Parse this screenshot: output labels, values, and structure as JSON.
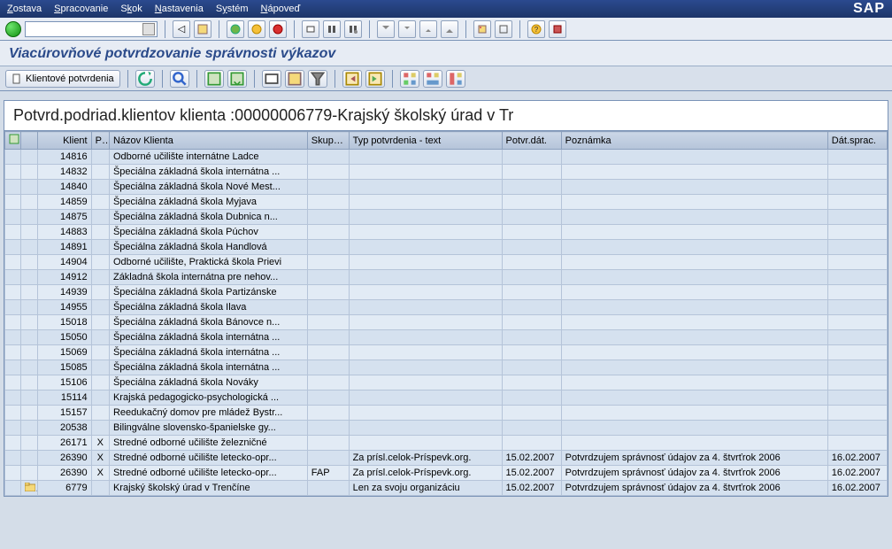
{
  "menu": {
    "items": [
      "Zostava",
      "Spracovanie",
      "Skok",
      "Nastavenia",
      "Systém",
      "Nápoveď"
    ],
    "logo": "SAP"
  },
  "page_title": "Viacúrovňové potvrdzovanie správnosti výkazov",
  "app_toolbar": {
    "client_confirm_label": "Klientové potvrdenia"
  },
  "grid": {
    "title": "Potvrd.podriad.klientov klienta :00000006779-Krajský školský úrad v Tr",
    "columns": {
      "klient": "Klient",
      "po": "PO",
      "nazov": "Názov Klienta",
      "skup": "SkupP...",
      "typ": "Typ potvrdenia - text",
      "potvr_dat": "Potvr.dát.",
      "poznamka": "Poznámka",
      "dat_sprac": "Dát.sprac."
    },
    "rows": [
      {
        "klient": "14816",
        "po": "",
        "nazov": "Odborné učilište internátne Ladce",
        "skup": "",
        "typ": "",
        "potvr": "",
        "pozn": "",
        "sprac": "",
        "icon": ""
      },
      {
        "klient": "14832",
        "po": "",
        "nazov": "Špeciálna základná škola internátna ...",
        "skup": "",
        "typ": "",
        "potvr": "",
        "pozn": "",
        "sprac": "",
        "icon": ""
      },
      {
        "klient": "14840",
        "po": "",
        "nazov": "Špeciálna základná škola Nové Mest...",
        "skup": "",
        "typ": "",
        "potvr": "",
        "pozn": "",
        "sprac": "",
        "icon": ""
      },
      {
        "klient": "14859",
        "po": "",
        "nazov": "Špeciálna základná škola Myjava",
        "skup": "",
        "typ": "",
        "potvr": "",
        "pozn": "",
        "sprac": "",
        "icon": ""
      },
      {
        "klient": "14875",
        "po": "",
        "nazov": "Špeciálna základná škola Dubnica n...",
        "skup": "",
        "typ": "",
        "potvr": "",
        "pozn": "",
        "sprac": "",
        "icon": ""
      },
      {
        "klient": "14883",
        "po": "",
        "nazov": "Špeciálna základná škola Púchov",
        "skup": "",
        "typ": "",
        "potvr": "",
        "pozn": "",
        "sprac": "",
        "icon": ""
      },
      {
        "klient": "14891",
        "po": "",
        "nazov": "Špeciálna základná škola Handlová",
        "skup": "",
        "typ": "",
        "potvr": "",
        "pozn": "",
        "sprac": "",
        "icon": ""
      },
      {
        "klient": "14904",
        "po": "",
        "nazov": "Odborné učilište, Praktická škola Prievi",
        "skup": "",
        "typ": "",
        "potvr": "",
        "pozn": "",
        "sprac": "",
        "icon": ""
      },
      {
        "klient": "14912",
        "po": "",
        "nazov": "Základná škola internátna pre nehov...",
        "skup": "",
        "typ": "",
        "potvr": "",
        "pozn": "",
        "sprac": "",
        "icon": ""
      },
      {
        "klient": "14939",
        "po": "",
        "nazov": "Špeciálna základná škola Partizánske",
        "skup": "",
        "typ": "",
        "potvr": "",
        "pozn": "",
        "sprac": "",
        "icon": ""
      },
      {
        "klient": "14955",
        "po": "",
        "nazov": "Špeciálna základná škola Ilava",
        "skup": "",
        "typ": "",
        "potvr": "",
        "pozn": "",
        "sprac": "",
        "icon": ""
      },
      {
        "klient": "15018",
        "po": "",
        "nazov": "Špeciálna základná škola Bánovce n...",
        "skup": "",
        "typ": "",
        "potvr": "",
        "pozn": "",
        "sprac": "",
        "icon": ""
      },
      {
        "klient": "15050",
        "po": "",
        "nazov": "Špeciálna základná škola internátna ...",
        "skup": "",
        "typ": "",
        "potvr": "",
        "pozn": "",
        "sprac": "",
        "icon": ""
      },
      {
        "klient": "15069",
        "po": "",
        "nazov": "Špeciálna základná škola internátna ...",
        "skup": "",
        "typ": "",
        "potvr": "",
        "pozn": "",
        "sprac": "",
        "icon": ""
      },
      {
        "klient": "15085",
        "po": "",
        "nazov": "Špeciálna základná škola internátna ...",
        "skup": "",
        "typ": "",
        "potvr": "",
        "pozn": "",
        "sprac": "",
        "icon": ""
      },
      {
        "klient": "15106",
        "po": "",
        "nazov": "Špeciálna základná škola Nováky",
        "skup": "",
        "typ": "",
        "potvr": "",
        "pozn": "",
        "sprac": "",
        "icon": ""
      },
      {
        "klient": "15114",
        "po": "",
        "nazov": "Krajská pedagogicko-psychologická ...",
        "skup": "",
        "typ": "",
        "potvr": "",
        "pozn": "",
        "sprac": "",
        "icon": ""
      },
      {
        "klient": "15157",
        "po": "",
        "nazov": "Reedukačný domov pre mládež Bystr...",
        "skup": "",
        "typ": "",
        "potvr": "",
        "pozn": "",
        "sprac": "",
        "icon": ""
      },
      {
        "klient": "20538",
        "po": "",
        "nazov": "Bilingválne slovensko-španielske gy...",
        "skup": "",
        "typ": "",
        "potvr": "",
        "pozn": "",
        "sprac": "",
        "icon": ""
      },
      {
        "klient": "26171",
        "po": "X",
        "nazov": "Stredné odborné učilište železničné",
        "skup": "",
        "typ": "",
        "potvr": "",
        "pozn": "",
        "sprac": "",
        "icon": ""
      },
      {
        "klient": "26390",
        "po": "X",
        "nazov": "Stredné odborné učilište letecko-opr...",
        "skup": "",
        "typ": "Za prísl.celok-Príspevk.org.",
        "potvr": "15.02.2007",
        "pozn": "Potvrdzujem správnosť údajov za 4. štvrťrok 2006",
        "sprac": "16.02.2007",
        "icon": ""
      },
      {
        "klient": "26390",
        "po": "X",
        "nazov": "Stredné odborné učilište letecko-opr...",
        "skup": "FAP",
        "typ": "Za prísl.celok-Príspevk.org.",
        "potvr": "15.02.2007",
        "pozn": "Potvrdzujem správnosť údajov za 4. štvrťrok 2006",
        "sprac": "16.02.2007",
        "icon": ""
      },
      {
        "klient": "6779",
        "po": "",
        "nazov": "Krajský školský úrad v Trenčíne",
        "skup": "",
        "typ": "Len za svoju organizáciu",
        "potvr": "15.02.2007",
        "pozn": "Potvrdzujem správnosť údajov za 4. štvrťrok 2006",
        "sprac": "16.02.2007",
        "icon": "folder"
      }
    ]
  }
}
